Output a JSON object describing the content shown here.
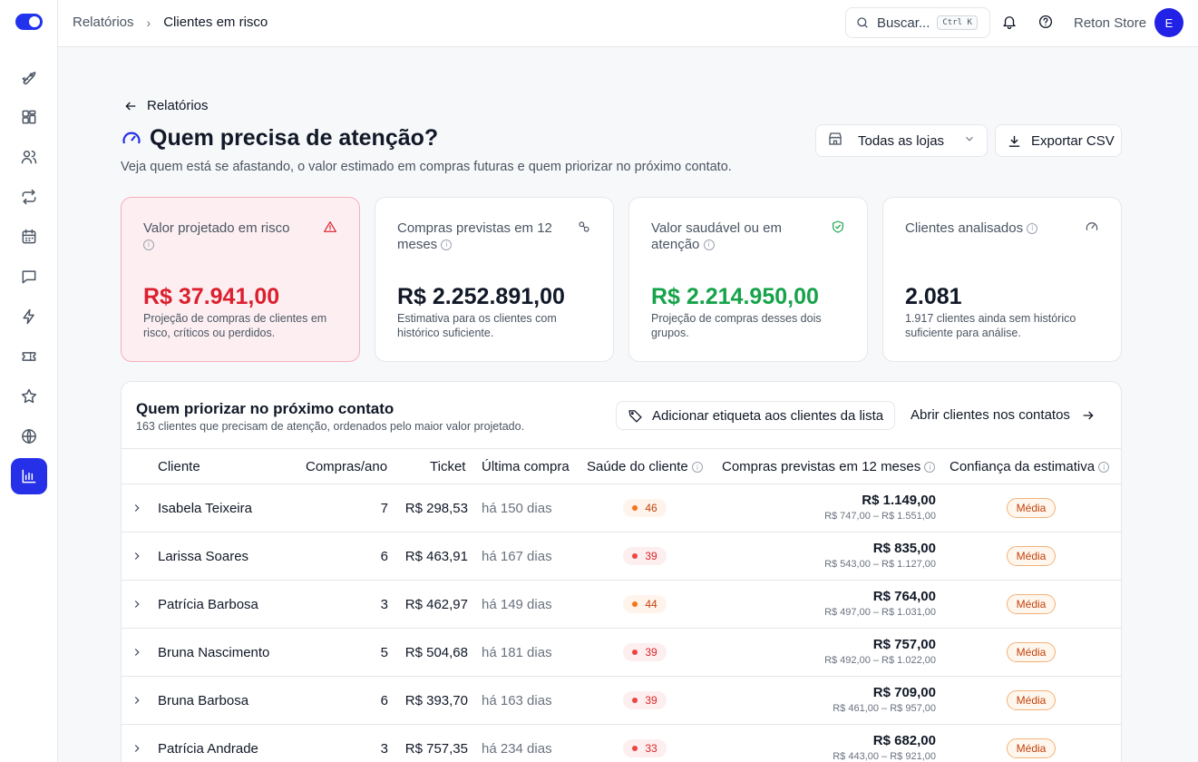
{
  "sidebar": {
    "icons": [
      "rocket-icon",
      "dashboard-icon",
      "users-icon",
      "repeat-icon",
      "calendar-icon",
      "chat-icon",
      "lightning-icon",
      "ticket-icon",
      "star-icon",
      "globe-icon",
      "chart-icon"
    ],
    "active": "chart-icon"
  },
  "topbar": {
    "breadcrumb_parent": "Relatórios",
    "breadcrumb_current": "Clientes em risco",
    "search_placeholder": "Buscar...",
    "search_shortcut": "Ctrl K",
    "store_name": "Reton Store",
    "avatar_initial": "E"
  },
  "header": {
    "back_label": "Relatórios",
    "title": "Quem precisa de atenção?",
    "subtitle": "Veja quem está se afastando, o valor estimado em compras futuras e quem priorizar no próximo contato.",
    "store_filter": "Todas as lojas",
    "export_label": "Exportar CSV"
  },
  "cards": [
    {
      "label": "Valor projetado em risco",
      "value": "R$ 37.941,00",
      "desc": "Projeção de compras de clientes em risco, críticos ou perdidos.",
      "color": "#dc1f2e",
      "icon": "warning-icon"
    },
    {
      "label": "Compras previstas em 12 meses",
      "value": "R$ 2.252.891,00",
      "desc": "Estimativa para os clientes com histórico suficiente.",
      "color": "#111827",
      "icon": "link-icon"
    },
    {
      "label": "Valor saudável ou em atenção",
      "value": "R$ 2.214.950,00",
      "desc": "Projeção de compras desses dois grupos.",
      "color": "#16a34a",
      "icon": "shield-check-icon"
    },
    {
      "label": "Clientes analisados",
      "value": "2.081",
      "desc": "1.917 clientes ainda sem histórico suficiente para análise.",
      "color": "#111827",
      "icon": "gauge-icon"
    }
  ],
  "table": {
    "title": "Quem priorizar no próximo contato",
    "subtitle": "163 clientes que precisam de atenção, ordenados pelo maior valor projetado.",
    "tag_button": "Adicionar etiqueta aos clientes da lista",
    "open_link": "Abrir clientes nos contatos",
    "headers": {
      "cliente": "Cliente",
      "compras": "Compras/ano",
      "ticket": "Ticket",
      "ultima": "Última compra",
      "saude": "Saúde do cliente",
      "previstas": "Compras previstas em 12 meses",
      "confianca": "Confiança da estimativa"
    },
    "rows": [
      {
        "name": "Isabela Teixeira",
        "compras": "7",
        "ticket": "R$ 298,53",
        "ultima": "há 150 dias",
        "health": "46",
        "health_level": "orange",
        "pred": "R$ 1.149,00",
        "range": "R$ 747,00 – R$ 1.551,00",
        "conf": "Média"
      },
      {
        "name": "Larissa Soares",
        "compras": "6",
        "ticket": "R$ 463,91",
        "ultima": "há 167 dias",
        "health": "39",
        "health_level": "red",
        "pred": "R$ 835,00",
        "range": "R$ 543,00 – R$ 1.127,00",
        "conf": "Média"
      },
      {
        "name": "Patrícia Barbosa",
        "compras": "3",
        "ticket": "R$ 462,97",
        "ultima": "há 149 dias",
        "health": "44",
        "health_level": "orange",
        "pred": "R$ 764,00",
        "range": "R$ 497,00 – R$ 1.031,00",
        "conf": "Média"
      },
      {
        "name": "Bruna Nascimento",
        "compras": "5",
        "ticket": "R$ 504,68",
        "ultima": "há 181 dias",
        "health": "39",
        "health_level": "red",
        "pred": "R$ 757,00",
        "range": "R$ 492,00 – R$ 1.022,00",
        "conf": "Média"
      },
      {
        "name": "Bruna Barbosa",
        "compras": "6",
        "ticket": "R$ 393,70",
        "ultima": "há 163 dias",
        "health": "39",
        "health_level": "red",
        "pred": "R$ 709,00",
        "range": "R$ 461,00 – R$ 957,00",
        "conf": "Média"
      },
      {
        "name": "Patrícia Andrade",
        "compras": "3",
        "ticket": "R$ 757,35",
        "ultima": "há 234 dias",
        "health": "33",
        "health_level": "red",
        "pred": "R$ 682,00",
        "range": "R$ 443,00 – R$ 921,00",
        "conf": "Média"
      }
    ]
  },
  "colors": {
    "accent": "#2530e8",
    "risk": "#dc1f2e",
    "healthy": "#16a34a",
    "health_orange_dot": "#f97316",
    "health_orange_bg": "#fff4ec",
    "health_orange_text": "#c2410c",
    "health_red_dot": "#ef4444",
    "health_red_bg": "#fdeef0",
    "health_red_text": "#dc2626"
  }
}
